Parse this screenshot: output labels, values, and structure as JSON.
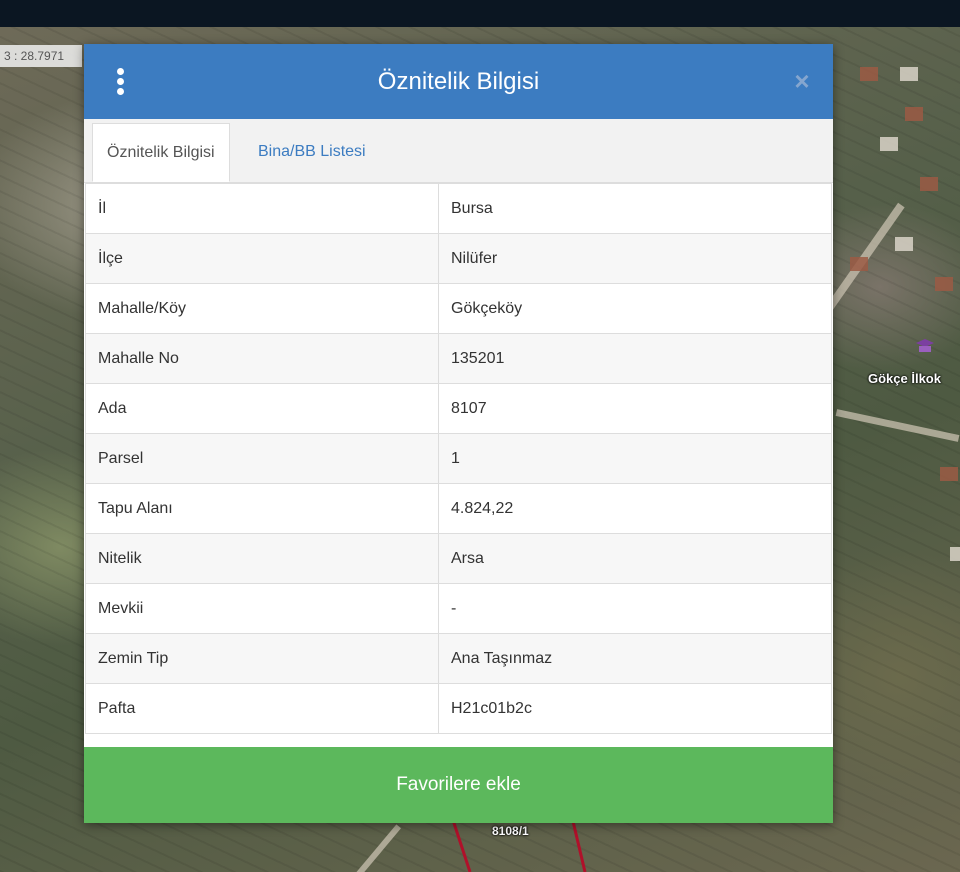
{
  "map": {
    "coordinate_readout": "3 : 28.7971",
    "poi_label": "Gökçe İlkok",
    "parcel_label": "8108/1"
  },
  "dialog": {
    "title": "Öznitelik Bilgisi",
    "menu_icon": "vertical-dots-icon",
    "close_icon": "close-icon",
    "close_symbol": "×",
    "tabs": [
      {
        "label": "Öznitelik Bilgisi",
        "active": true
      },
      {
        "label": "Bina/BB Listesi",
        "active": false
      }
    ],
    "rows": [
      {
        "key": "İl",
        "value": "Bursa"
      },
      {
        "key": "İlçe",
        "value": "Nilüfer"
      },
      {
        "key": "Mahalle/Köy",
        "value": "Gökçeköy"
      },
      {
        "key": "Mahalle No",
        "value": "135201"
      },
      {
        "key": "Ada",
        "value": "8107"
      },
      {
        "key": "Parsel",
        "value": "1"
      },
      {
        "key": "Tapu Alanı",
        "value": "4.824,22"
      },
      {
        "key": "Nitelik",
        "value": "Arsa"
      },
      {
        "key": "Mevkii",
        "value": "-"
      },
      {
        "key": "Zemin Tip",
        "value": "Ana Taşınmaz"
      },
      {
        "key": "Pafta",
        "value": "H21c01b2c"
      }
    ],
    "favorite_button_label": "Favorilere ekle"
  },
  "colors": {
    "header": "#3c7cc1",
    "button": "#5cb85c",
    "topbar": "#0b1622",
    "parcel_line": "#b0102a"
  }
}
